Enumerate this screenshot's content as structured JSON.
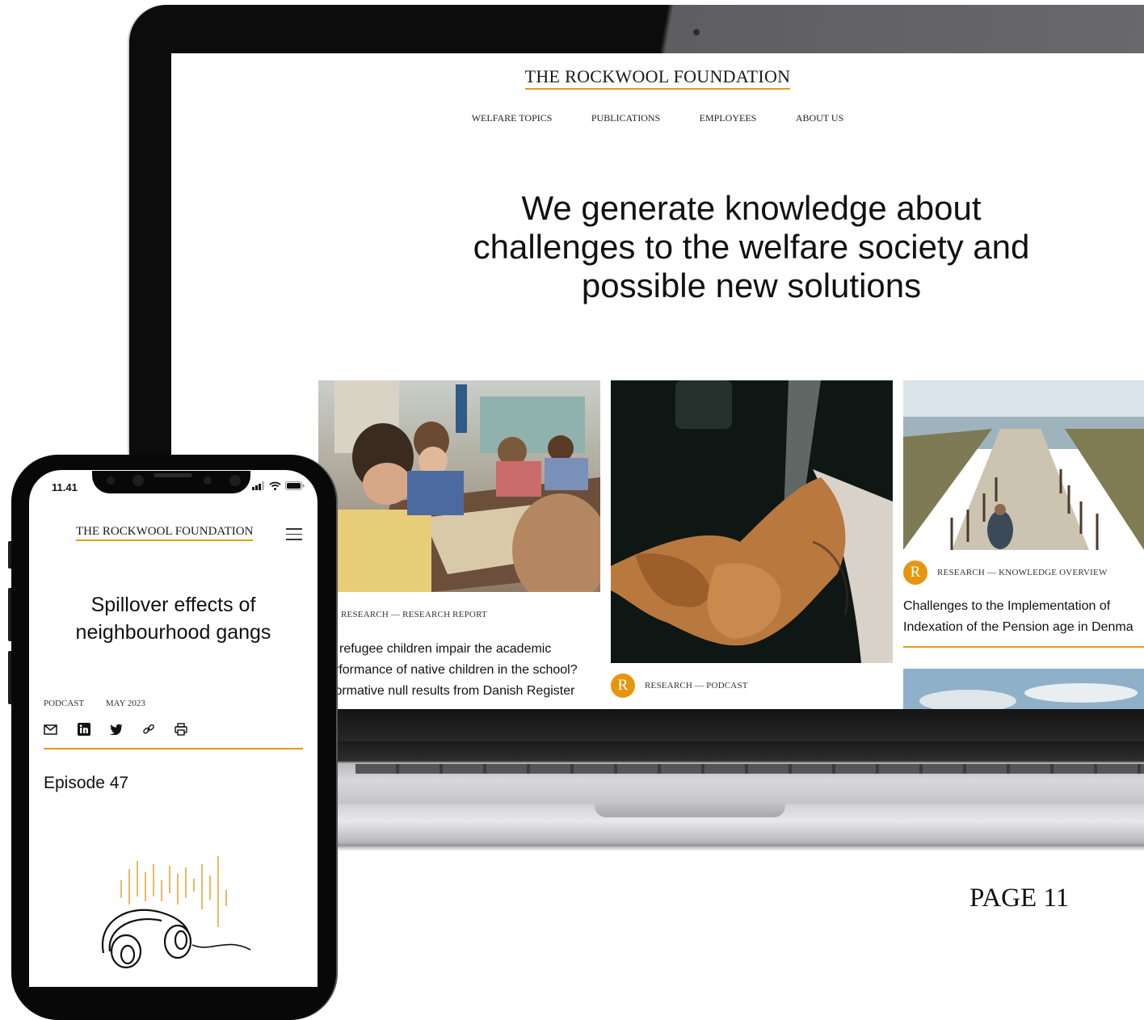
{
  "site": {
    "logo": "THE ROCKWOOL FOUNDATION",
    "nav": [
      "WELFARE TOPICS",
      "PUBLICATIONS",
      "EMPLOYEES",
      "ABOUT US"
    ],
    "hero": "We generate knowledge about challenges to the welfare society and possible new solutions",
    "cards": [
      {
        "badge": "R",
        "category": "RESEARCH — RESEARCH REPORT",
        "lines": [
          "refugee children impair the academic",
          "rformance of native children in the school?",
          "formative null results from Danish Register"
        ]
      },
      {
        "badge": "R",
        "category": "RESEARCH — PODCAST"
      },
      {
        "badge": "R",
        "category": "RESEARCH — KNOWLEDGE OVERVIEW",
        "lines": [
          "Challenges to the Implementation of",
          "Indexation of the Pension age in Denma"
        ]
      }
    ]
  },
  "phone": {
    "time": "11.41",
    "logo": "THE ROCKWOOL FOUNDATION",
    "title": "Spillover effects of neighbourhood gangs",
    "meta_type": "PODCAST",
    "meta_date": "MAY 2023",
    "episode": "Episode 47",
    "share_icons": [
      "mail-icon",
      "linkedin-icon",
      "twitter-icon",
      "link-icon",
      "print-icon"
    ]
  },
  "page_label": "PAGE 11",
  "colors": {
    "accent": "#e39a1b",
    "badge": "#e8950e",
    "device": "#0c0c0d"
  }
}
